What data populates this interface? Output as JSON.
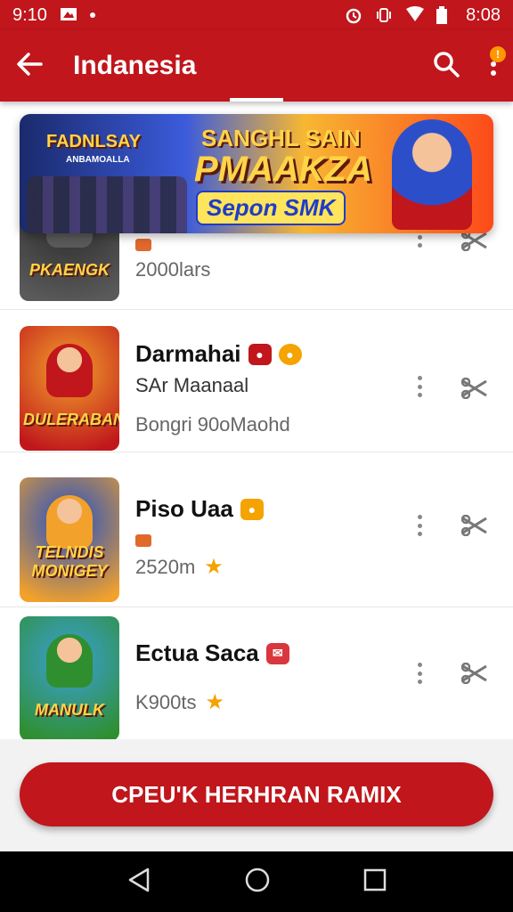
{
  "status_bar": {
    "time_left": "9:10",
    "time_right": "8:08"
  },
  "app_bar": {
    "title": "Indanesia",
    "badge": "!"
  },
  "banner": {
    "logo_left": "FADNLSAY",
    "logo_left_sub": "ANBAMOALLA",
    "line1": "SANGHL SAIN",
    "line2": "PMAAKZA",
    "line3": "Sepon SMK"
  },
  "games": [
    {
      "name": "",
      "subtitle": "",
      "meta": "2000lars",
      "thumb_text": "PKAENGK",
      "thumb_colors": [
        "#2c2c2c",
        "#5a5a5a"
      ],
      "tag_color": "#e0692c",
      "rating": false
    },
    {
      "name": "Darmahai",
      "subtitle": "SAr Maanaal",
      "meta": "Bongri 90oMaohd",
      "thumb_text": "DULERABAN",
      "thumb_colors": [
        "#f2a12b",
        "#c0161c"
      ],
      "tag_color": "#c0161c",
      "tag2_color": "#f4a300",
      "rating": false
    },
    {
      "name": "Piso Uaa",
      "subtitle": "",
      "meta": "2520m",
      "thumb_text": "TELNDIS MONIGEY",
      "thumb_colors": [
        "#1f4fc7",
        "#f2a12b"
      ],
      "tag_color": "#f4a300",
      "rating": true
    },
    {
      "name": "Ectua Saca",
      "subtitle": "",
      "meta": "K900ts",
      "thumb_text": "MANULK",
      "thumb_colors": [
        "#3aa0d8",
        "#2f8f2f"
      ],
      "tag_color": "#d9363e",
      "rating": true
    }
  ],
  "cta": {
    "label": "CPEU'K HERHRAN RAMIX"
  },
  "colors": {
    "primary": "#c0161c",
    "accent": "#f4a300"
  }
}
